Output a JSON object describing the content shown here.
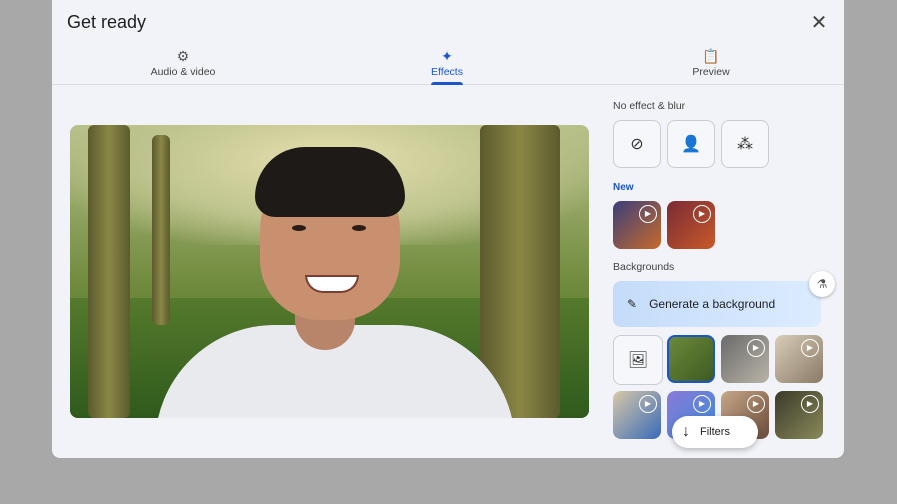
{
  "dialog": {
    "title": "Get ready"
  },
  "tabs": [
    {
      "label": "Audio & video",
      "icon": "audio-video-settings-icon",
      "active": false
    },
    {
      "label": "Effects",
      "icon": "sparkle-icon",
      "active": true
    },
    {
      "label": "Preview",
      "icon": "preview-clipboard-icon",
      "active": false
    }
  ],
  "effects": {
    "no_effect_label": "No effect & blur",
    "blur_buttons": [
      "no-effect-icon",
      "slight-blur-icon",
      "blur-icon"
    ],
    "new_label": "New",
    "backgrounds_label": "Backgrounds",
    "generate_label": "Generate a background",
    "filters_label": "Filters"
  },
  "colors": {
    "accent": "#1a56c9",
    "generate_bg": "#cfe3fd",
    "dialog_bg": "#f1f3f8"
  }
}
